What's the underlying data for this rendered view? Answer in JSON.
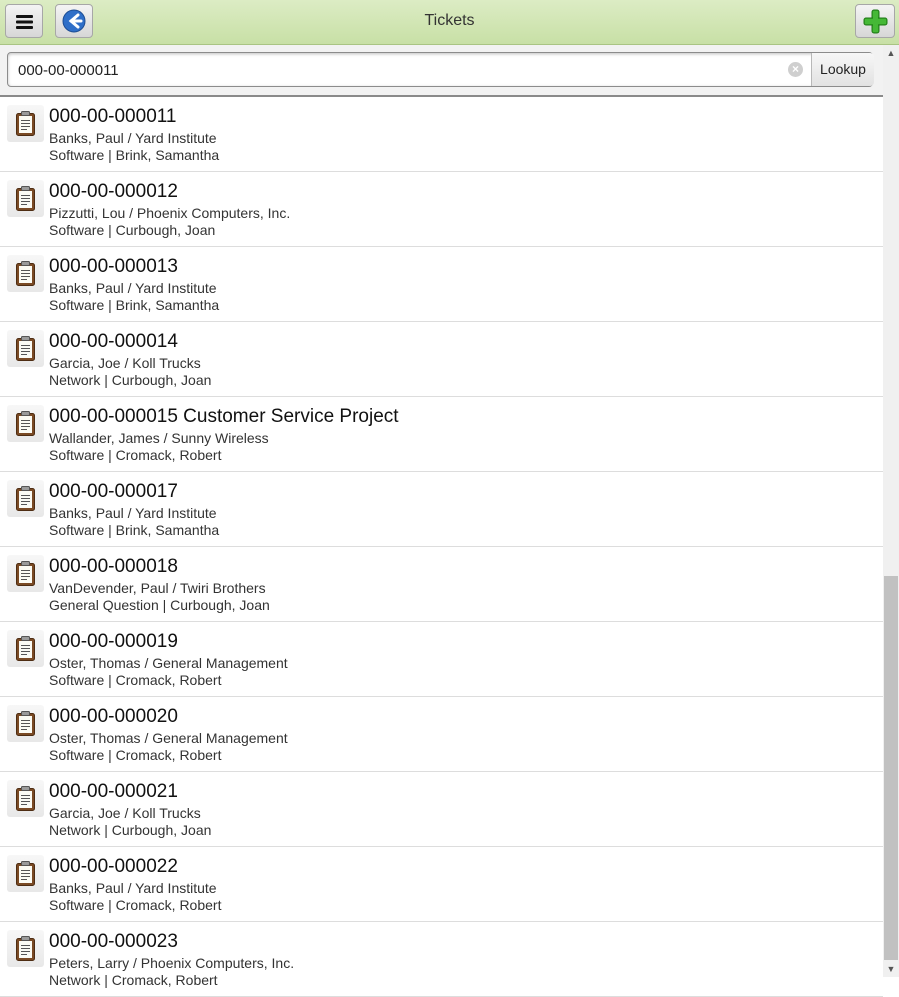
{
  "header": {
    "title": "Tickets",
    "menu_icon": "menu-icon",
    "back_icon": "back-arrow-icon",
    "add_icon": "plus-icon"
  },
  "search": {
    "value": "000-00-000011",
    "lookup_label": "Lookup",
    "clear_icon": "clear-icon"
  },
  "tickets": [
    {
      "title": "000-00-000011",
      "line1": "Banks, Paul / Yard Institute",
      "line2": "Software | Brink, Samantha"
    },
    {
      "title": "000-00-000012",
      "line1": "Pizzutti, Lou / Phoenix Computers, Inc.",
      "line2": "Software | Curbough, Joan"
    },
    {
      "title": "000-00-000013",
      "line1": "Banks, Paul / Yard Institute",
      "line2": "Software | Brink, Samantha"
    },
    {
      "title": "000-00-000014",
      "line1": "Garcia, Joe / Koll Trucks",
      "line2": "Network | Curbough, Joan"
    },
    {
      "title": "000-00-000015 Customer Service Project",
      "line1": "Wallander, James / Sunny Wireless",
      "line2": "Software | Cromack, Robert"
    },
    {
      "title": "000-00-000017",
      "line1": "Banks, Paul / Yard Institute",
      "line2": "Software | Brink, Samantha"
    },
    {
      "title": "000-00-000018",
      "line1": "VanDevender, Paul / Twiri Brothers",
      "line2": "General Question | Curbough, Joan"
    },
    {
      "title": "000-00-000019",
      "line1": "Oster, Thomas / General Management",
      "line2": "Software | Cromack, Robert"
    },
    {
      "title": "000-00-000020",
      "line1": "Oster, Thomas / General Management",
      "line2": "Software | Cromack, Robert"
    },
    {
      "title": "000-00-000021",
      "line1": "Garcia, Joe / Koll Trucks",
      "line2": "Network | Curbough, Joan"
    },
    {
      "title": "000-00-000022",
      "line1": "Banks, Paul / Yard Institute",
      "line2": "Software | Cromack, Robert"
    },
    {
      "title": "000-00-000023",
      "line1": "Peters, Larry / Phoenix Computers, Inc.",
      "line2": "Network | Cromack, Robert"
    }
  ],
  "ticket_icon": "clipboard-icon",
  "colors": {
    "header_bg": "#c8e0a6",
    "add_green": "#3aa82b",
    "back_blue": "#2f6fc8"
  }
}
